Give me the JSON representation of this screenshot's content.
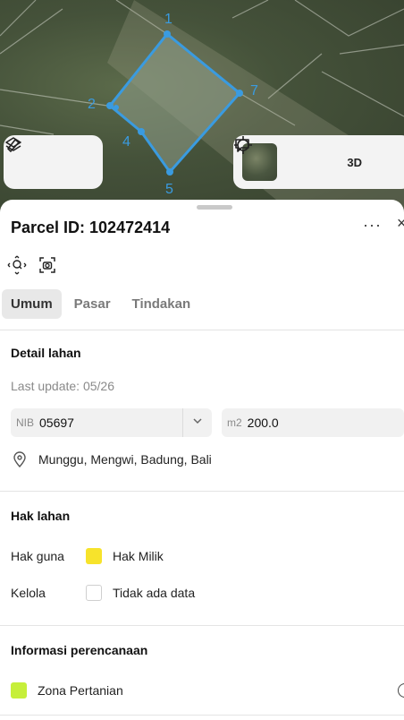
{
  "map": {
    "vertex_labels": [
      "1",
      "2",
      "7",
      "4",
      "5"
    ],
    "controls": {
      "layers_icon": "layers-icon",
      "measure_icon": "ruler-icon",
      "locate_icon": "crosshair-icon",
      "view_3d_label": "3D",
      "feedback_icon": "chat-icon"
    },
    "polygon_color": "#3a9be0"
  },
  "panel": {
    "title": "Parcel ID: 102472414",
    "more_label": "···",
    "close_label": "×",
    "tabs": [
      {
        "label": "Umum",
        "active": true
      },
      {
        "label": "Pasar",
        "active": false
      },
      {
        "label": "Tindakan",
        "active": false
      }
    ],
    "detail": {
      "heading": "Detail lahan",
      "last_update": "Last update: 05/26",
      "nib_label": "NIB",
      "nib_value": "05697",
      "area_label": "m2",
      "area_value": "200.0",
      "address": "Munggu, Mengwi, Badung, Bali"
    },
    "hak": {
      "heading": "Hak lahan",
      "hak_guna_label": "Hak guna",
      "hak_guna_value": "Hak Milik",
      "hak_guna_color": "#f7e32b",
      "kelola_label": "Kelola",
      "kelola_value": "Tidak ada data"
    },
    "planning": {
      "heading": "Informasi perencanaan",
      "zone_label": "Zona Pertanian",
      "zone_color": "#c6ef3a"
    }
  }
}
